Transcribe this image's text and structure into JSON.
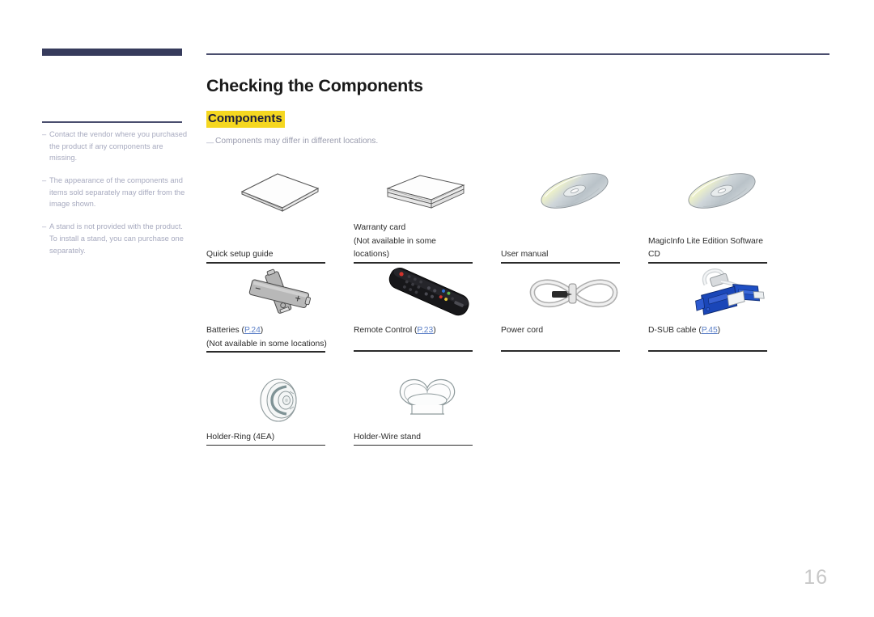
{
  "document": {
    "page_number": "16",
    "title": "Checking the Components",
    "section_heading": "Components",
    "section_note": "Components may differ in different locations.",
    "dash": "—",
    "note_dash": "–"
  },
  "sidebar": {
    "notes": [
      "Contact the vendor where you purchased the product if any components are missing.",
      "The appearance of the components and items sold separately may differ from the image shown.",
      "A stand is not provided with the product. To install a stand, you can purchase one separately."
    ]
  },
  "colors": {
    "navy_bar": "#363b5c",
    "rule": "#4a4e6e",
    "highlight": "#f5d720",
    "link": "#5b7fc7",
    "note_text": "#a7aabf",
    "page_number": "#c8c8c8"
  },
  "components": {
    "rows": [
      {
        "items": [
          {
            "icon": "booklet-icon",
            "label_line1": "Quick setup guide",
            "label_line2": "",
            "label_line3": "",
            "link": "",
            "link_suffix": ""
          },
          {
            "icon": "card-stack-icon",
            "label_line1": "Warranty card",
            "label_line2": "(Not available in some",
            "label_line3": "locations)",
            "link": "",
            "link_suffix": ""
          },
          {
            "icon": "cd-disc-icon",
            "label_line1": "User manual",
            "label_line2": "",
            "label_line3": "",
            "link": "",
            "link_suffix": ""
          },
          {
            "icon": "cd-disc-icon",
            "label_line1": "MagicInfo Lite Edition Software",
            "label_line2": "CD",
            "label_line3": "",
            "link": "",
            "link_suffix": ""
          }
        ]
      },
      {
        "items": [
          {
            "icon": "batteries-icon",
            "label_line1": "Batteries (",
            "label_line2": "(Not available in some locations)",
            "label_line3": "",
            "link": "P.24",
            "link_suffix": ")"
          },
          {
            "icon": "remote-control-icon",
            "label_line1": "Remote Control (",
            "label_line2": "",
            "label_line3": "",
            "link": "P.23",
            "link_suffix": ")"
          },
          {
            "icon": "power-cord-icon",
            "label_line1": "Power cord",
            "label_line2": "",
            "label_line3": "",
            "link": "",
            "link_suffix": ""
          },
          {
            "icon": "dsub-cable-icon",
            "label_line1": "D-SUB cable (",
            "label_line2": "",
            "label_line3": "",
            "link": "P.45",
            "link_suffix": ")"
          }
        ]
      },
      {
        "items": [
          {
            "icon": "holder-ring-icon",
            "label_line1": "Holder-Ring (4EA)",
            "label_line2": "",
            "label_line3": "",
            "link": "",
            "link_suffix": ""
          },
          {
            "icon": "holder-wire-stand-icon",
            "label_line1": "Holder-Wire stand",
            "label_line2": "",
            "label_line3": "",
            "link": "",
            "link_suffix": ""
          }
        ]
      }
    ]
  }
}
